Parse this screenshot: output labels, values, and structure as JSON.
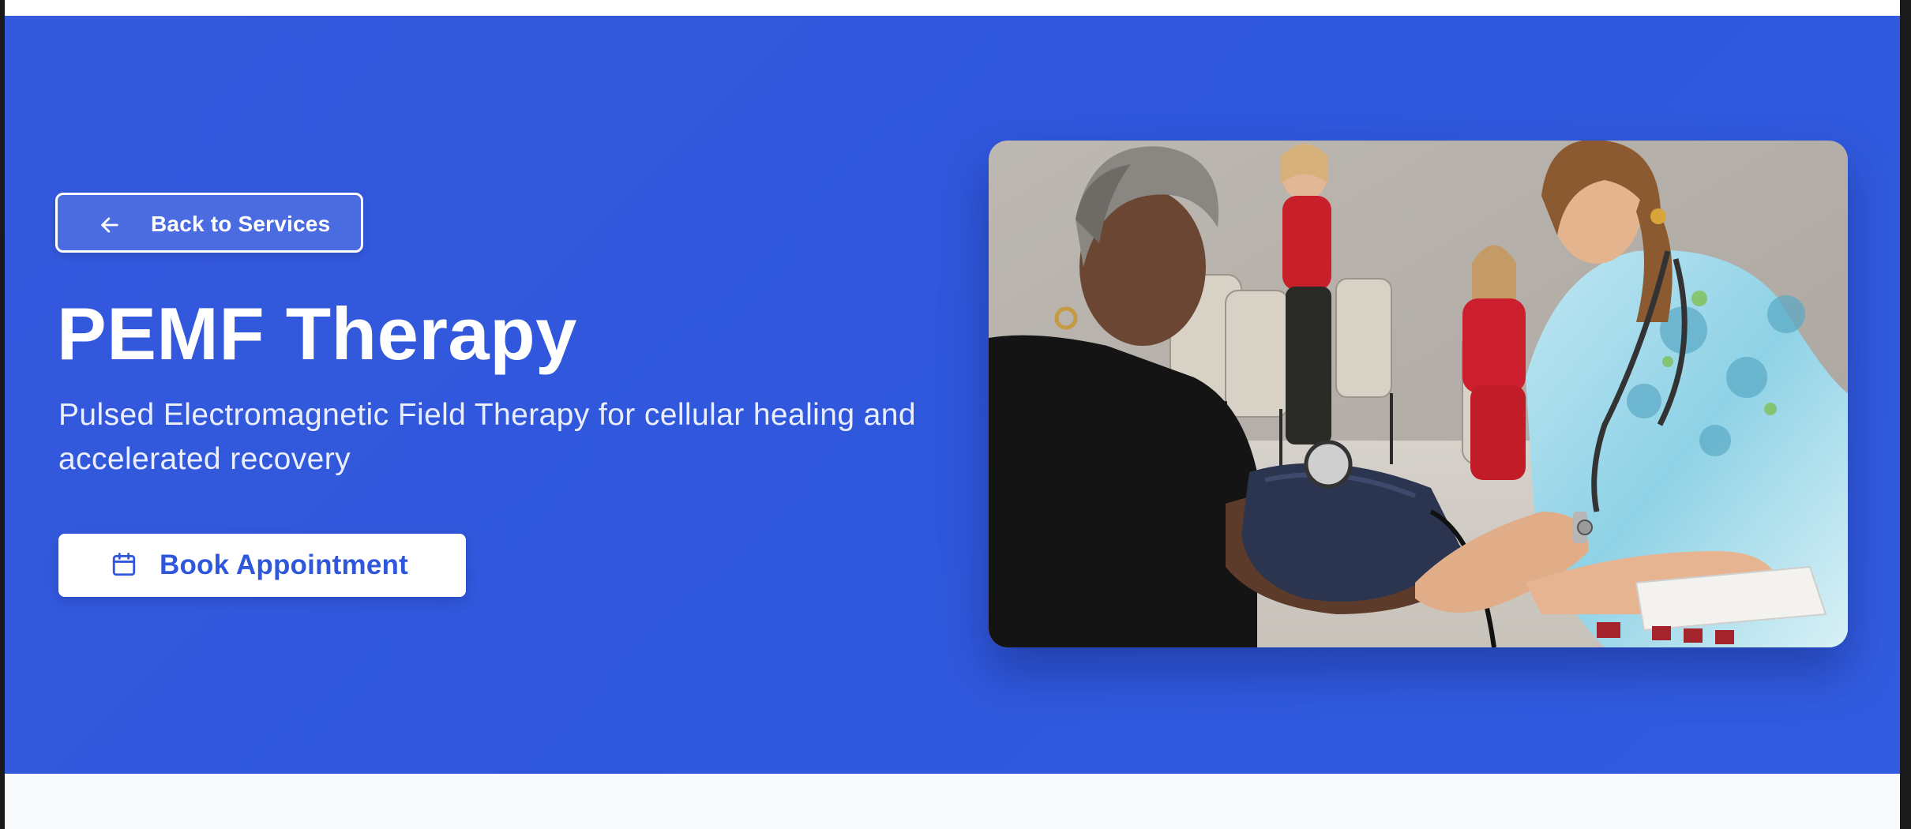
{
  "hero": {
    "back_label": "Back to Services",
    "title": "PEMF Therapy",
    "subtitle": "Pulsed Electromagnetic Field Therapy for cellular healing and accelerated recovery",
    "book_label": "Book Appointment",
    "back_icon": "arrow-left-icon",
    "book_icon": "calendar-icon",
    "image_icon": "clinic-photo"
  },
  "colors": {
    "hero_background": "#2f57dc",
    "button_text": "#2f57dc",
    "page_background": "#f8fafc",
    "text_light": "#ffffff"
  }
}
